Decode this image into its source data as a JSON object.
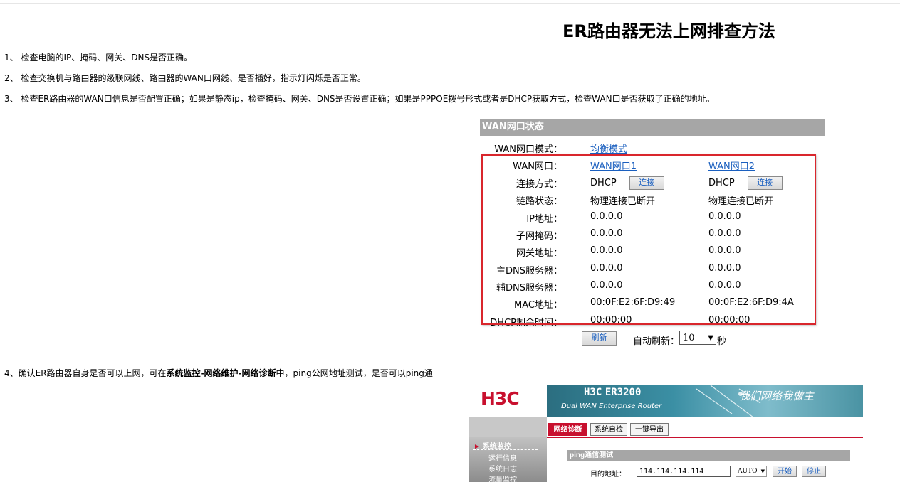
{
  "title": "ER路由器无法上网排查方法",
  "steps": {
    "s1": "1、 检查电脑的IP、掩码、网关、DNS是否正确。",
    "s2": "2、 检查交换机与路由器的级联网线、路由器的WAN口网线、是否插好，指示灯闪烁是否正常。",
    "s3": "3、 检查ER路由器的WAN口信息是否配置正确；如果是静态ip，检查掩码、网关、DNS是否设置正确；如果是PPPOE拨号形式或者是DHCP获取方式，检查WAN口是否获取了正确的地址。",
    "s4_prefix": "4、确认ER路由器自身是否可以上网，可在",
    "s4_bold": "系统监控-网络维护-网络诊断",
    "s4_suffix": "中，ping公网地址测试，是否可以ping通"
  },
  "wan": {
    "header": "WAN网口状态",
    "mode_label": "WAN网口模式：",
    "mode_value": "均衡模式",
    "rows": [
      {
        "label": "WAN网口：",
        "v1": "WAN网口1",
        "v2": "WAN网口2"
      },
      {
        "label": "连接方式：",
        "v1": "DHCP",
        "v2": "DHCP"
      },
      {
        "label": "链路状态：",
        "v1": "物理连接已断开",
        "v2": "物理连接已断开"
      },
      {
        "label": "IP地址：",
        "v1": "0.0.0.0",
        "v2": "0.0.0.0"
      },
      {
        "label": "子网掩码：",
        "v1": "0.0.0.0",
        "v2": "0.0.0.0"
      },
      {
        "label": "网关地址：",
        "v1": "0.0.0.0",
        "v2": "0.0.0.0"
      },
      {
        "label": "主DNS服务器：",
        "v1": "0.0.0.0",
        "v2": "0.0.0.0"
      },
      {
        "label": "辅DNS服务器：",
        "v1": "0.0.0.0",
        "v2": "0.0.0.0"
      },
      {
        "label": "MAC地址：",
        "v1": "00:0F:E2:6F:D9:49",
        "v2": "00:0F:E2:6F:D9:4A"
      },
      {
        "label": "DHCP剩余时间：",
        "v1": "00:00:00",
        "v2": "00:00:00"
      }
    ],
    "connect_label": "连接",
    "refresh_label": "刷新",
    "auto_refresh_label": "自动刷新：",
    "auto_refresh_value": "10",
    "seconds_label": "秒"
  },
  "h3c": {
    "logo": "H3C",
    "product_prefix": "H3C",
    "product_model": "ER3200",
    "product_sub": "Dual WAN Enterprise Router",
    "slogan": "我们网络我做主",
    "tabs": [
      "网络诊断",
      "系统自检",
      "一键导出"
    ],
    "side_selected": "系统监控",
    "side_items": [
      "运行信息",
      "系统日志",
      "流量监控"
    ],
    "ping_header": "ping通信测试",
    "dest_label": "目的地址：",
    "dest_value": "114.114.114.114",
    "auto_value": "AUTO",
    "start_label": "开始",
    "stop_label": "停止"
  },
  "colors": {
    "accent_red": "#d9262c",
    "link_blue": "#1a5fbf",
    "header_gray": "#a6a6a6",
    "brand_red": "#c8102e"
  }
}
